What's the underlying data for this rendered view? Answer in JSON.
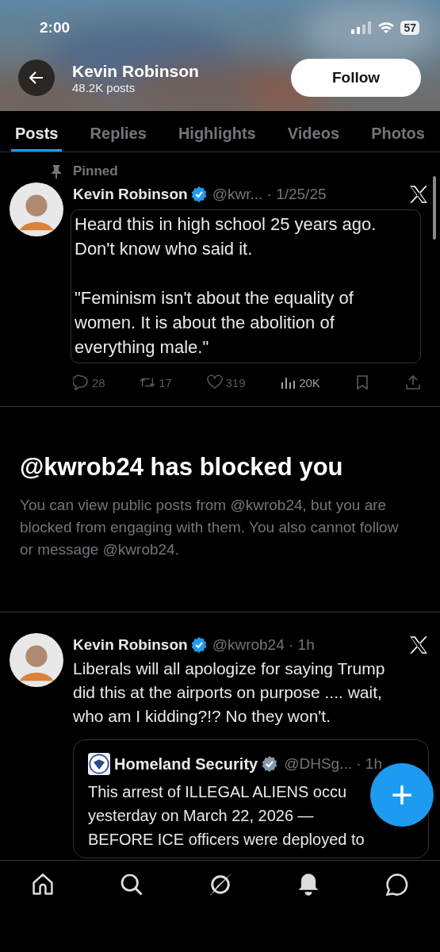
{
  "status_bar": {
    "time": "2:00",
    "battery": "57"
  },
  "header": {
    "name": "Kevin Robinson",
    "posts": "48.2K posts",
    "follow": "Follow"
  },
  "tabs": [
    {
      "label": "Posts",
      "selected": true
    },
    {
      "label": "Replies",
      "selected": false
    },
    {
      "label": "Highlights",
      "selected": false
    },
    {
      "label": "Videos",
      "selected": false
    },
    {
      "label": "Photos",
      "selected": false
    }
  ],
  "pinned_post": {
    "pinned": "Pinned",
    "name": "Kevin Robinson",
    "badge": {
      "color": "#1d9bf0"
    },
    "meta": "@kwr... · 1/25/25",
    "text": [
      "Heard this in high school 25 years ago. Don't know who said it.",
      "\"Feminism isn't about the equality of women. It is about the abolition of everything male.\""
    ],
    "stats": [
      {
        "kind": "reply",
        "count": "28"
      },
      {
        "kind": "repost",
        "count": "17"
      },
      {
        "kind": "like",
        "count": "319"
      },
      {
        "kind": "views",
        "count": "20K"
      },
      {
        "kind": "bookmark"
      },
      {
        "kind": "share"
      }
    ]
  },
  "blocked": {
    "title": "@kwrob24 has blocked you",
    "text": "You can view public posts from @kwrob24, but you are blocked from engaging with them. You also cannot follow or message @kwrob24."
  },
  "post": {
    "name": "Kevin Robinson",
    "badge": {
      "color": "#1d9bf0"
    },
    "meta": "@kwrob24 · 1h",
    "text": "Liberals will all apologize for saying Trump did this at the airports on purpose .... wait, who am I kidding?!?  No they won't.",
    "quote": {
      "name": "Homeland Security",
      "badge": {
        "color": "#829aab"
      },
      "meta": "@DHSg... · 1h",
      "lines": [
        "This arrest of ILLEGAL ALIENS occu",
        "yesterday on March 22, 2026 —",
        "BEFORE ICE officers were deployed to"
      ]
    }
  },
  "fab": "+",
  "nav": [
    {
      "kind": "home"
    },
    {
      "kind": "search"
    },
    {
      "kind": "grok"
    },
    {
      "kind": "notifications"
    },
    {
      "kind": "messages"
    }
  ]
}
